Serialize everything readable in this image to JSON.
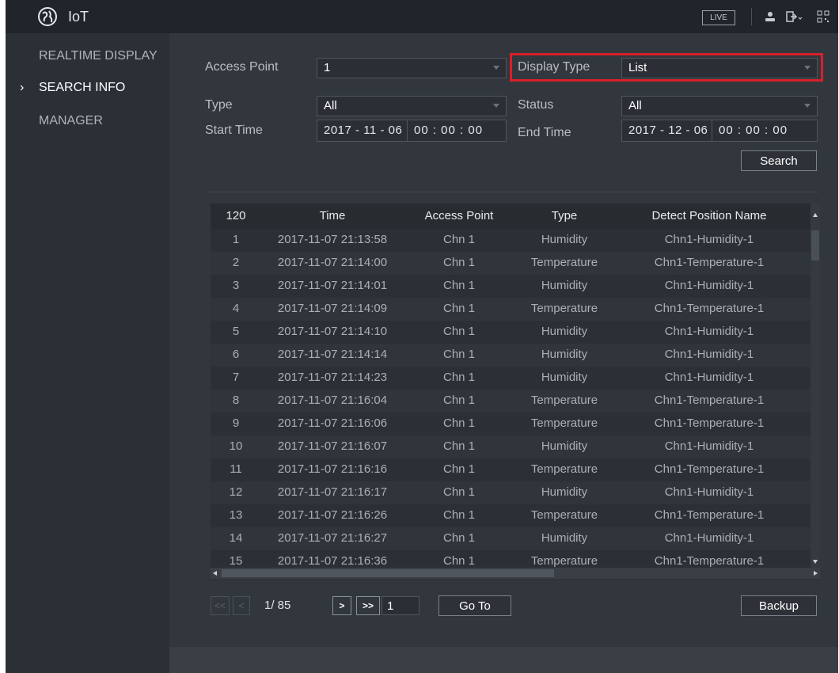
{
  "app": {
    "title": "IoT",
    "live_label": "LIVE"
  },
  "sidebar": {
    "items": [
      {
        "label": "REALTIME DISPLAY",
        "active": false
      },
      {
        "label": "SEARCH INFO",
        "active": true
      },
      {
        "label": "MANAGER",
        "active": false
      }
    ],
    "active_marker": "›"
  },
  "filters": {
    "access_point_label": "Access Point",
    "access_point_value": "1",
    "display_type_label": "Display Type",
    "display_type_value": "List",
    "type_label": "Type",
    "type_value": "All",
    "status_label": "Status",
    "status_value": "All",
    "start_time_label": "Start Time",
    "start_date": "2017 - 11 - 06",
    "start_time": "00 : 00 : 00",
    "end_time_label": "End Time",
    "end_date": "2017 - 12 - 06",
    "end_time": "00 : 00 : 00",
    "search_label": "Search"
  },
  "table": {
    "columns": [
      "120",
      "Time",
      "Access Point",
      "Type",
      "Detect Position Name"
    ],
    "rows": [
      [
        "1",
        "2017-11-07 21:13:58",
        "Chn 1",
        "Humidity",
        "Chn1-Humidity-1"
      ],
      [
        "2",
        "2017-11-07 21:14:00",
        "Chn 1",
        "Temperature",
        "Chn1-Temperature-1"
      ],
      [
        "3",
        "2017-11-07 21:14:01",
        "Chn 1",
        "Humidity",
        "Chn1-Humidity-1"
      ],
      [
        "4",
        "2017-11-07 21:14:09",
        "Chn 1",
        "Temperature",
        "Chn1-Temperature-1"
      ],
      [
        "5",
        "2017-11-07 21:14:10",
        "Chn 1",
        "Humidity",
        "Chn1-Humidity-1"
      ],
      [
        "6",
        "2017-11-07 21:14:14",
        "Chn 1",
        "Humidity",
        "Chn1-Humidity-1"
      ],
      [
        "7",
        "2017-11-07 21:14:23",
        "Chn 1",
        "Humidity",
        "Chn1-Humidity-1"
      ],
      [
        "8",
        "2017-11-07 21:16:04",
        "Chn 1",
        "Temperature",
        "Chn1-Temperature-1"
      ],
      [
        "9",
        "2017-11-07 21:16:06",
        "Chn 1",
        "Temperature",
        "Chn1-Temperature-1"
      ],
      [
        "10",
        "2017-11-07 21:16:07",
        "Chn 1",
        "Humidity",
        "Chn1-Humidity-1"
      ],
      [
        "11",
        "2017-11-07 21:16:16",
        "Chn 1",
        "Temperature",
        "Chn1-Temperature-1"
      ],
      [
        "12",
        "2017-11-07 21:16:17",
        "Chn 1",
        "Humidity",
        "Chn1-Humidity-1"
      ],
      [
        "13",
        "2017-11-07 21:16:26",
        "Chn 1",
        "Temperature",
        "Chn1-Temperature-1"
      ],
      [
        "14",
        "2017-11-07 21:16:27",
        "Chn 1",
        "Humidity",
        "Chn1-Humidity-1"
      ],
      [
        "15",
        "2017-11-07 21:16:36",
        "Chn 1",
        "Temperature",
        "Chn1-Temperature-1"
      ]
    ]
  },
  "pagination": {
    "first_label": "<<",
    "prev_label": "<",
    "page_text": "1/ 85",
    "next_label": ">",
    "last_label": ">>",
    "page_input_value": "1",
    "goto_label": "Go To",
    "backup_label": "Backup"
  },
  "colors": {
    "highlight": "#d8202a",
    "background": "#32373e",
    "sidebar": "#2b3037"
  }
}
